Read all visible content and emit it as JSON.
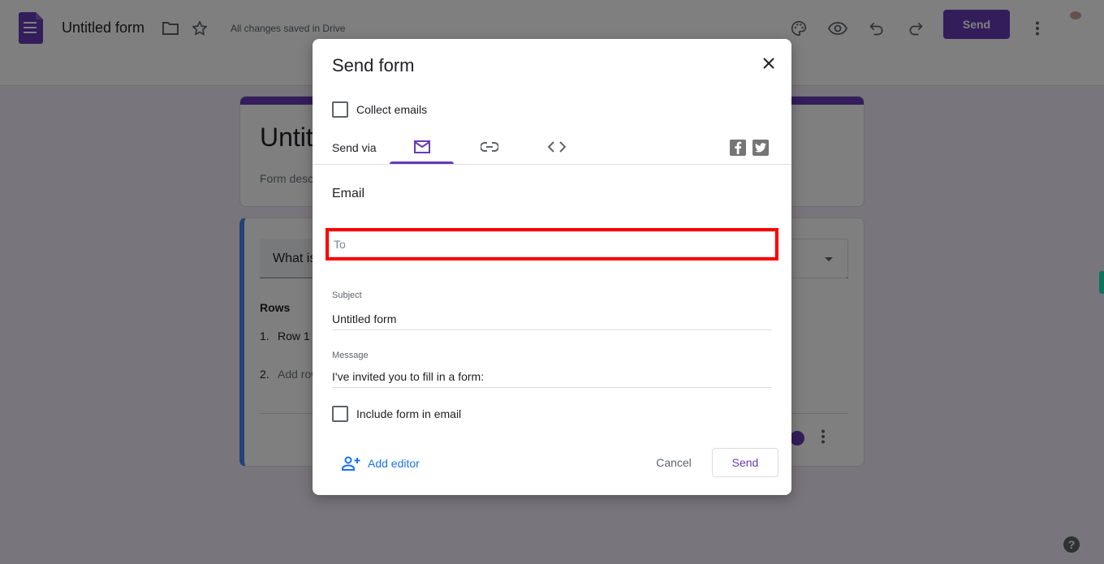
{
  "header": {
    "app_title": "Untitled form",
    "save_status": "All changes saved in Drive",
    "send_label": "Send",
    "icons": [
      "forms-logo-icon",
      "folder-icon",
      "star-icon",
      "palette-icon",
      "eye-icon",
      "undo-icon",
      "redo-icon",
      "more-vert-icon",
      "avatar"
    ]
  },
  "form": {
    "title": "Untitled form",
    "description_placeholder": "Form description",
    "question": {
      "title": "What is",
      "rows_label": "Rows",
      "rows": [
        {
          "num": "1.",
          "label": "Row 1"
        },
        {
          "num": "2.",
          "label": "Add row"
        }
      ]
    }
  },
  "dialog": {
    "title": "Send form",
    "collect_emails_label": "Collect emails",
    "collect_emails_checked": false,
    "send_via_label": "Send via",
    "tabs": [
      {
        "name": "email",
        "icon": "mail-icon",
        "active": true
      },
      {
        "name": "link",
        "icon": "link-icon",
        "active": false
      },
      {
        "name": "embed",
        "icon": "code-icon",
        "active": false
      }
    ],
    "social": [
      "facebook-icon",
      "twitter-icon"
    ],
    "section_title": "Email",
    "to": {
      "placeholder": "To",
      "value": ""
    },
    "subject": {
      "label": "Subject",
      "value": "Untitled form"
    },
    "message": {
      "label": "Message",
      "value": "I've invited you to fill in a form:"
    },
    "include_form_label": "Include form in email",
    "include_form_checked": false,
    "add_editor_label": "Add editor",
    "cancel_label": "Cancel",
    "send_label": "Send"
  },
  "colors": {
    "accent": "#673ab7",
    "link": "#1a73e8",
    "highlight": "#ff0000"
  }
}
